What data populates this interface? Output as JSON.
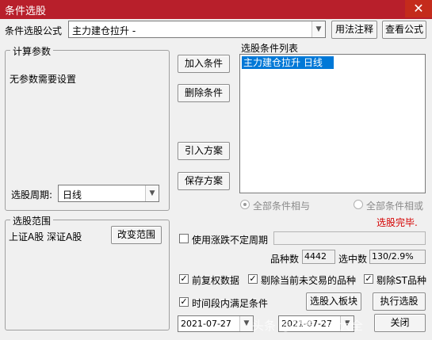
{
  "window": {
    "title": "条件选股",
    "close_glyph": "✕"
  },
  "formula": {
    "label": "条件选股公式",
    "value": "主力建仓拉升 -",
    "usage_button": "用法注释",
    "view_button": "查看公式"
  },
  "params": {
    "group_title": "计算参数",
    "message": "无参数需要设置",
    "period_label": "选股周期:",
    "period_value": "日线"
  },
  "actions": {
    "add": "加入条件",
    "delete": "删除条件",
    "import": "引入方案",
    "save": "保存方案"
  },
  "conditions": {
    "label": "选股条件列表",
    "items": [
      "主力建仓拉升  日线"
    ]
  },
  "logic": {
    "all_and": "全部条件相与",
    "all_or": "全部条件相或"
  },
  "status": {
    "text": "选股完毕.",
    "color": "#d40000"
  },
  "range": {
    "group_title": "选股范围",
    "value": "上证A股 深证A股",
    "change_button": "改变范围"
  },
  "options": {
    "use_limit_period": "使用涨跌不定周期",
    "stock_count_label": "品种数",
    "stock_count_value": "4442",
    "selected_label": "选中数",
    "selected_value": "130/2.9%",
    "pre_adjust": "前复权数据",
    "exclude_untraded": "剔除当前未交易的品种",
    "exclude_st": "剔除ST品种",
    "time_range": "时间段内满足条件"
  },
  "buttons": {
    "add_to_board": "选股入板块",
    "execute": "执行选股",
    "close": "关闭"
  },
  "dates": {
    "start": "2021-07-27",
    "end": "2021-07-27"
  },
  "watermark": "头条 @股票公式大全"
}
